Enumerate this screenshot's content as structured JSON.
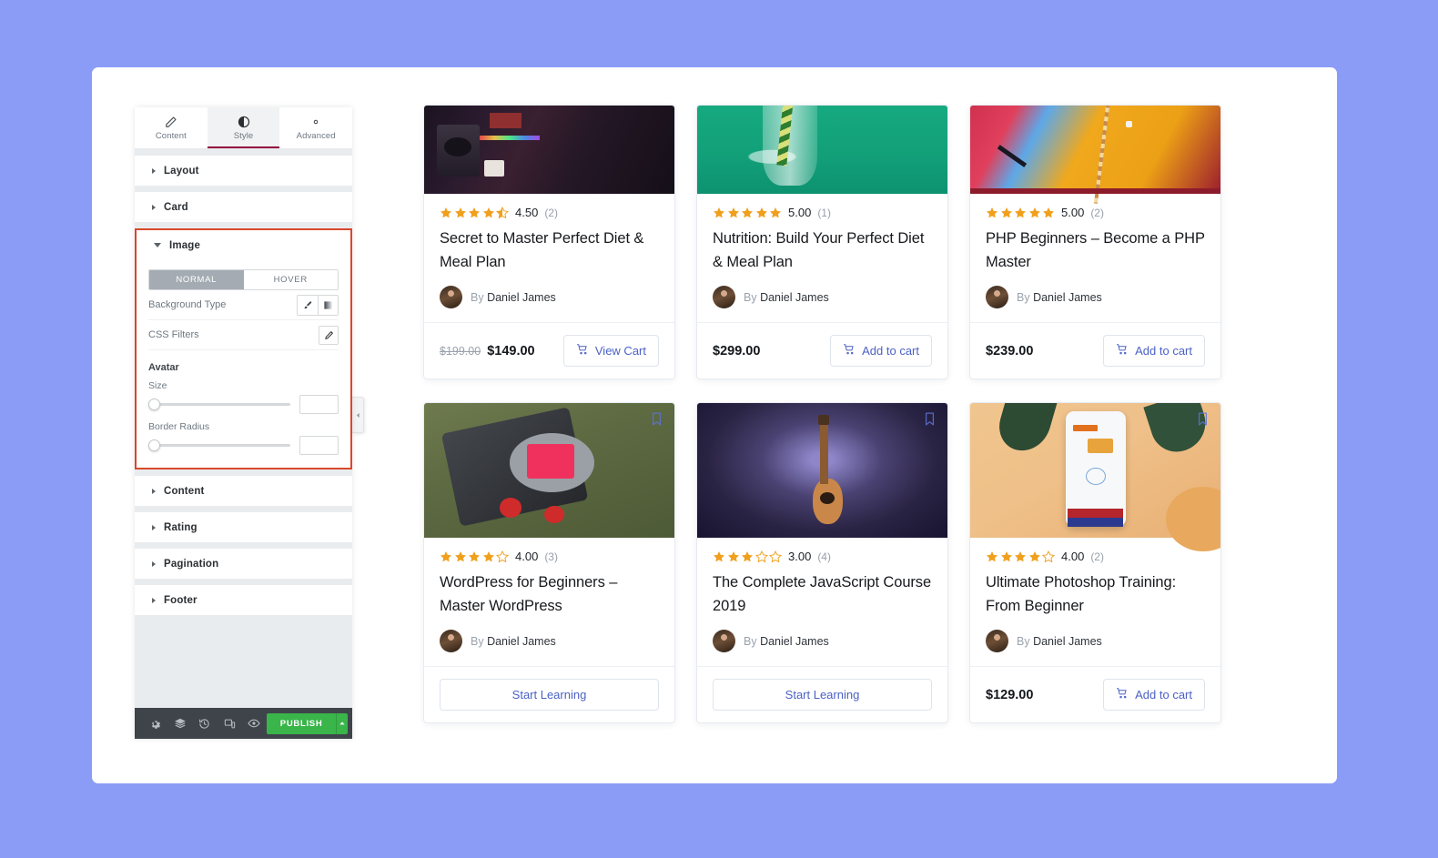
{
  "panel": {
    "tabs": [
      {
        "label": "Content",
        "icon": "pencil-icon",
        "active": false
      },
      {
        "label": "Style",
        "icon": "contrast-icon",
        "active": true
      },
      {
        "label": "Advanced",
        "icon": "gear-icon",
        "active": false
      }
    ],
    "sections_above": [
      {
        "label": "Layout"
      },
      {
        "label": "Card"
      }
    ],
    "image_section": {
      "label": "Image",
      "state_tabs": {
        "normal": "NORMAL",
        "hover": "HOVER",
        "selected": "NORMAL"
      },
      "background_type": {
        "label": "Background Type",
        "options": [
          "brush-icon",
          "gradient-icon"
        ]
      },
      "css_filters": {
        "label": "CSS Filters",
        "edit_icon": "pencil-edit-icon"
      },
      "avatar": {
        "title": "Avatar",
        "size": {
          "label": "Size",
          "value": "",
          "slider_pct": 0
        },
        "border_radius": {
          "label": "Border Radius",
          "value": "",
          "slider_pct": 0
        }
      }
    },
    "sections_below": [
      {
        "label": "Content"
      },
      {
        "label": "Rating"
      },
      {
        "label": "Pagination"
      },
      {
        "label": "Footer"
      }
    ],
    "footer_toolbar": {
      "icons": [
        "settings-gear-icon",
        "layers-icon",
        "history-icon",
        "responsive-mode-icon",
        "preview-eye-icon"
      ],
      "publish_label": "PUBLISH",
      "publish_arrow": "chevron-up-icon",
      "publish_color": "#39b54a"
    },
    "collapse_handle": "chevron-left-icon",
    "highlight_color": "#d9472b",
    "active_tab_underline": "#93003c"
  },
  "cards": [
    {
      "thumb": "audio-studio-dark",
      "clipped_top": true,
      "bookmark": false,
      "rating": {
        "value": "4.50",
        "count": "(2)",
        "stars": 4.5
      },
      "title": "Secret to Master Perfect Diet & Meal Plan",
      "author": {
        "by": "By",
        "name": "Daniel James"
      },
      "price_old": "$199.00",
      "price": "$149.00",
      "action": {
        "label": "View Cart",
        "icon": "cart-icon",
        "style": "inline"
      }
    },
    {
      "thumb": "green-glass",
      "clipped_top": true,
      "bookmark": false,
      "rating": {
        "value": "5.00",
        "count": "(1)",
        "stars": 5
      },
      "title": "Nutrition: Build Your Perfect Diet & Meal Plan",
      "author": {
        "by": "By",
        "name": "Daniel James"
      },
      "price_old": "",
      "price": "$299.00",
      "action": {
        "label": "Add to cart",
        "icon": "cart-icon",
        "style": "inline"
      }
    },
    {
      "thumb": "colorful-geometry",
      "clipped_top": true,
      "bookmark": false,
      "rating": {
        "value": "5.00",
        "count": "(2)",
        "stars": 5
      },
      "title": "PHP Beginners – Become a PHP Master",
      "author": {
        "by": "By",
        "name": "Daniel James"
      },
      "price_old": "",
      "price": "$239.00",
      "action": {
        "label": "Add to cart",
        "icon": "cart-icon",
        "style": "inline"
      }
    },
    {
      "thumb": "camera-green",
      "clipped_top": false,
      "bookmark": true,
      "rating": {
        "value": "4.00",
        "count": "(3)",
        "stars": 4
      },
      "title": "WordPress for Beginners – Master WordPress",
      "author": {
        "by": "By",
        "name": "Daniel James"
      },
      "price_old": "",
      "price": "",
      "action": {
        "label": "Start Learning",
        "icon": "",
        "style": "wide"
      }
    },
    {
      "thumb": "guitar-purple",
      "clipped_top": false,
      "bookmark": true,
      "rating": {
        "value": "3.00",
        "count": "(4)",
        "stars": 3
      },
      "title": "The Complete JavaScript Course 2019",
      "author": {
        "by": "By",
        "name": "Daniel James"
      },
      "price_old": "",
      "price": "",
      "action": {
        "label": "Start Learning",
        "icon": "",
        "style": "wide"
      }
    },
    {
      "thumb": "phone-payment",
      "clipped_top": false,
      "bookmark": true,
      "rating": {
        "value": "4.00",
        "count": "(2)",
        "stars": 4
      },
      "title": "Ultimate Photoshop Training: From Beginner",
      "author": {
        "by": "By",
        "name": "Daniel James"
      },
      "price_old": "",
      "price": "$129.00",
      "action": {
        "label": "Add to cart",
        "icon": "cart-icon",
        "style": "inline"
      }
    }
  ],
  "theme": {
    "page_background": "#8b9cf7",
    "star_color": "#f0a01e",
    "link_color": "#4b61c4"
  }
}
